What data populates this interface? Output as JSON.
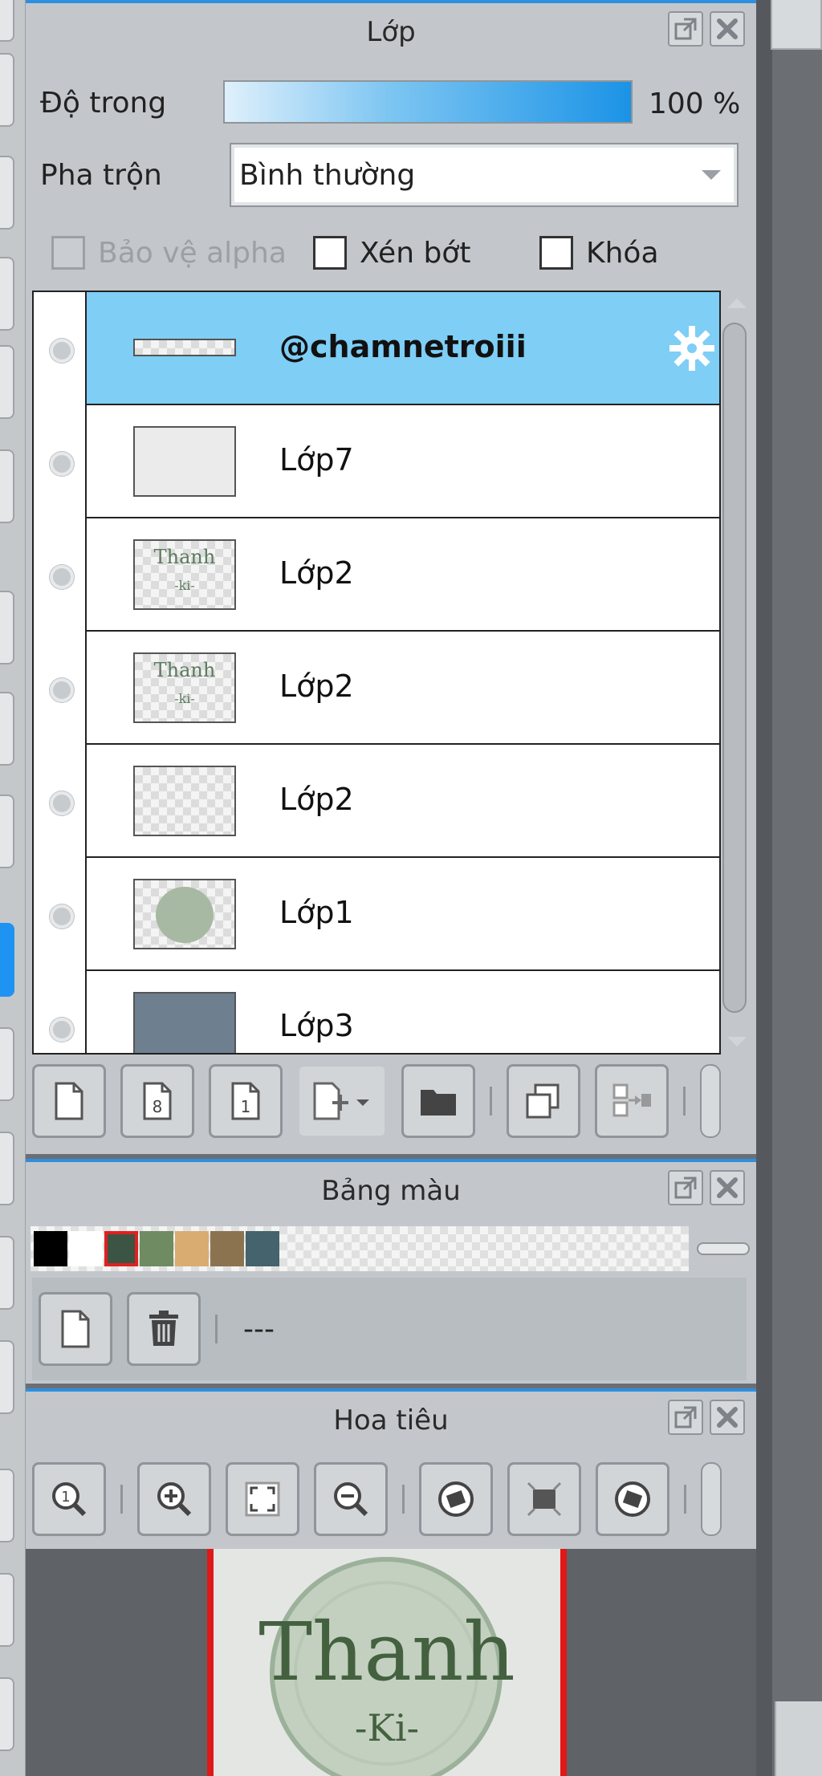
{
  "layer_panel": {
    "title": "Lớp",
    "opacity_label": "Độ trong",
    "opacity_value": "100 %",
    "opacity_fraction": 1.0,
    "blend_label": "Pha trộn",
    "blend_value": "Bình thường",
    "protect_alpha_label": "Bảo vệ alpha",
    "clipping_label": "Xén bớt",
    "lock_label": "Khóa",
    "layers": [
      {
        "name": "@chamnetroiii",
        "selected": true
      },
      {
        "name": "Lớp7"
      },
      {
        "name": "Lớp2",
        "thumb_text": "Thanh",
        "thumb_sub": "-ki-"
      },
      {
        "name": "Lớp2",
        "thumb_text": "Thanh",
        "thumb_sub": "-ki-"
      },
      {
        "name": "Lớp2"
      },
      {
        "name": "Lớp1"
      },
      {
        "name": "Lớp3"
      }
    ]
  },
  "palette_panel": {
    "title": "Bảng màu",
    "palette_name": "---",
    "swatches": [
      "#000000",
      "#ffffff",
      "#3b5443",
      "#6f8b62",
      "#d9ad72",
      "#8c7350",
      "#45636c"
    ],
    "selected_swatch": 2
  },
  "navigator_panel": {
    "title": "Hoa tiêu",
    "canvas_text": "Thanh",
    "canvas_sub": "-Ki-"
  },
  "colors": {
    "accent": "#2e8fe0",
    "selection": "#7ecef6",
    "active_tool": "#1f93f2"
  }
}
